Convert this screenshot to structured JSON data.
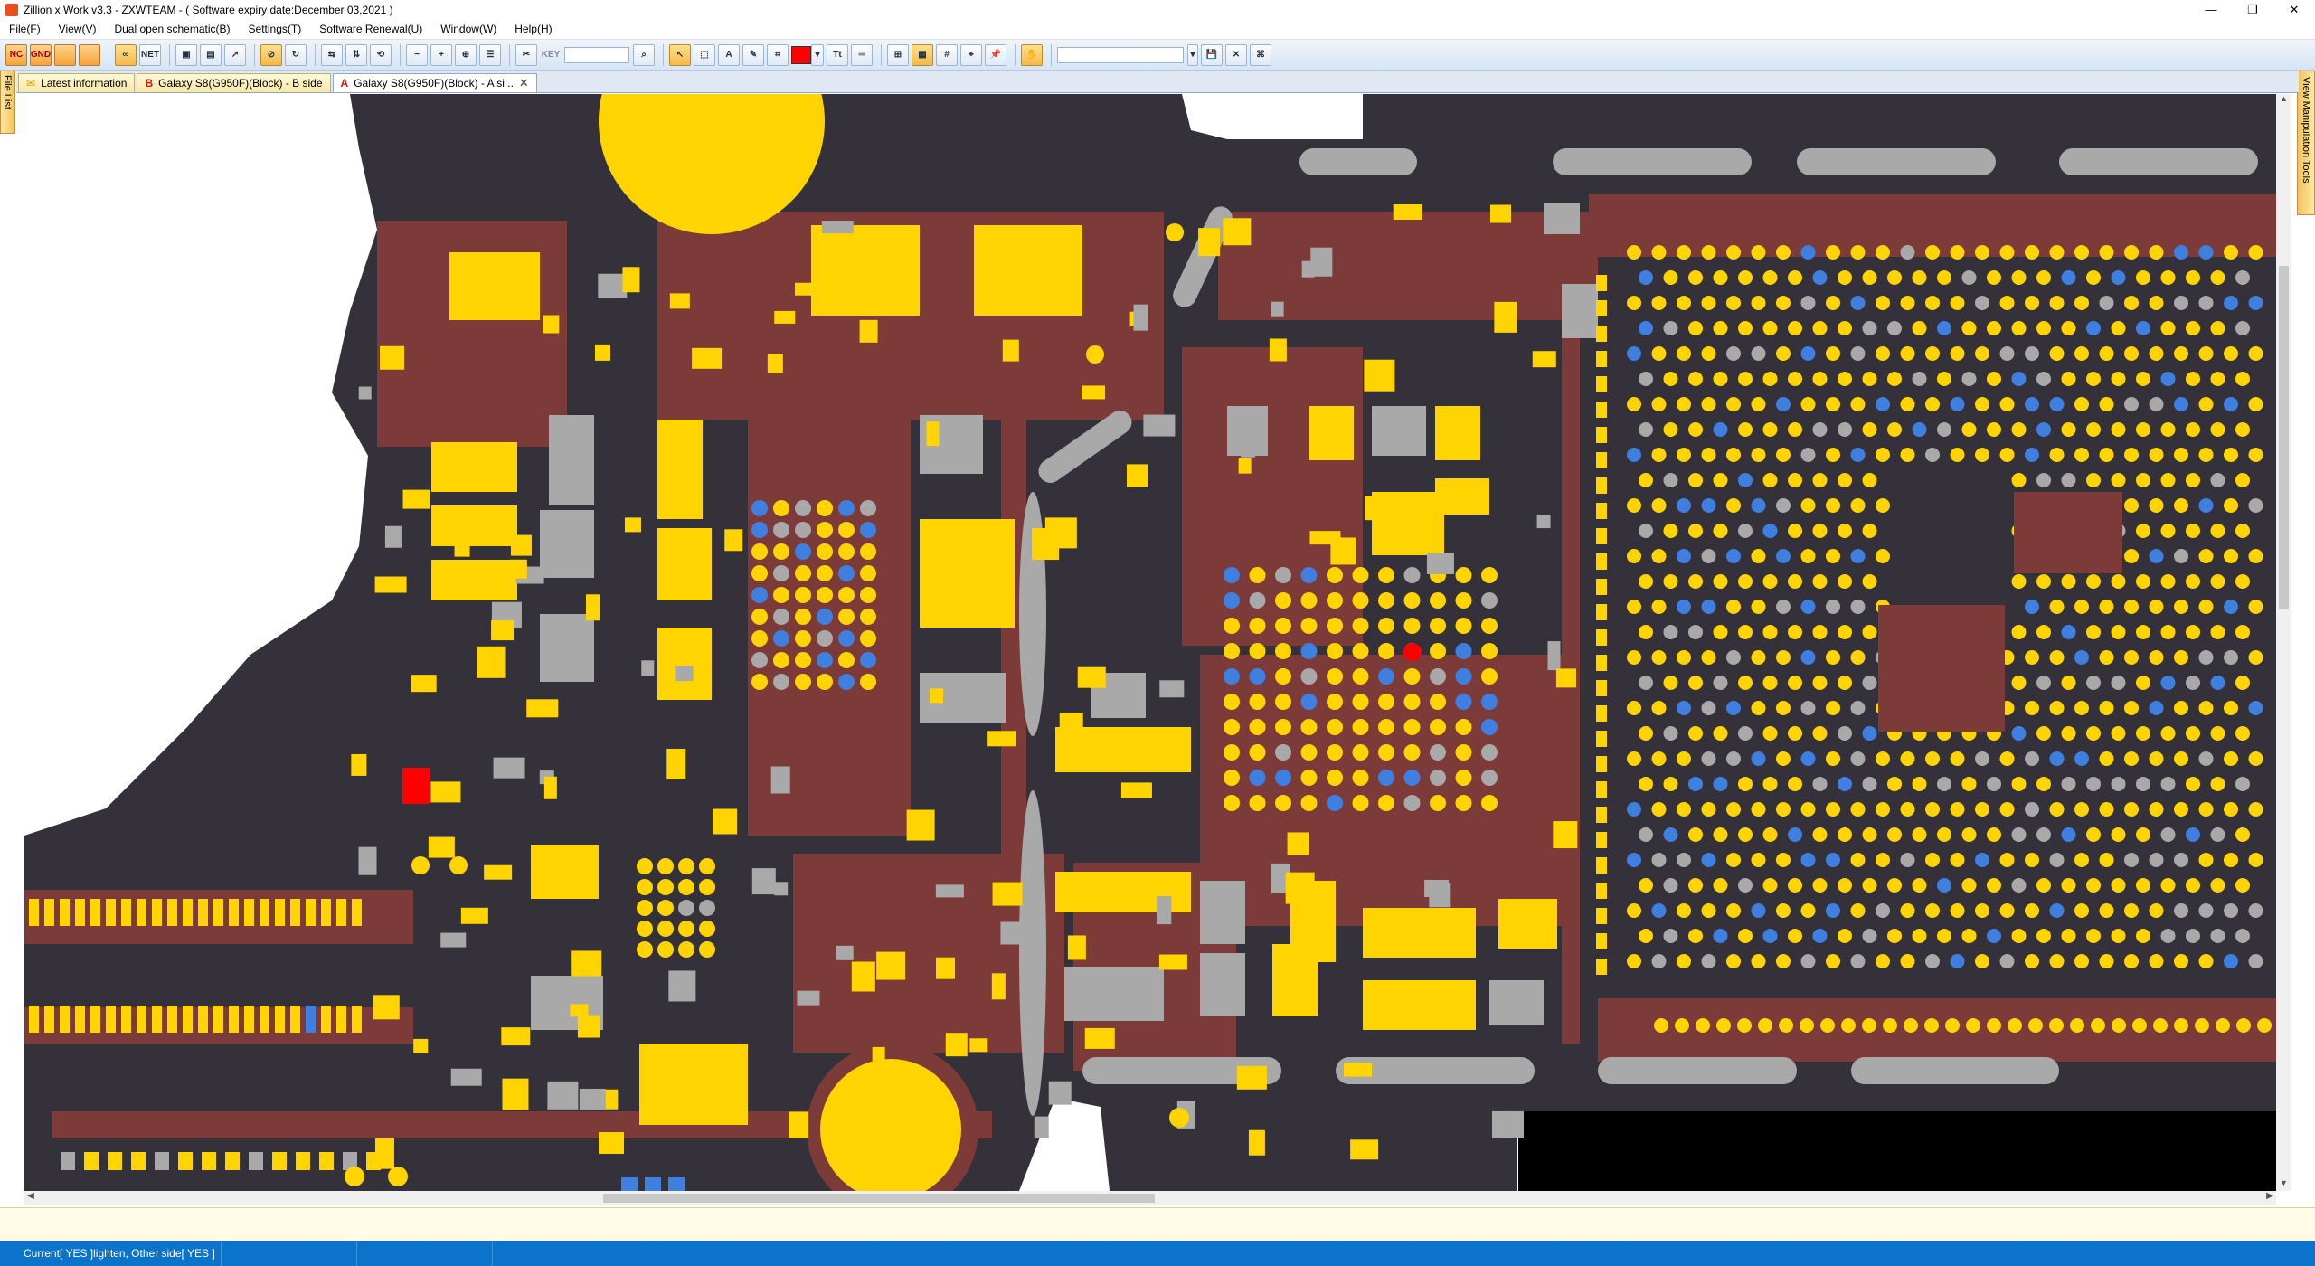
{
  "window": {
    "title": "Zillion x Work v3.3 - ZXWTEAM - ( Software expiry date:December 03,2021 )",
    "minimize": "—",
    "maximize": "❐",
    "close": "✕"
  },
  "menu": [
    "File(F)",
    "View(V)",
    "Dual open schematic(B)",
    "Settings(T)",
    "Software Renewal(U)",
    "Window(W)",
    "Help(H)"
  ],
  "toolbar": {
    "nc_label": "NC",
    "gnd_label": "GND",
    "net_label": "NET",
    "key_label": "KEY",
    "text_tool_label": "A",
    "font_tool_label": "Tt",
    "highlight_color": "#ff0000"
  },
  "tabs": [
    {
      "marker": "",
      "label": "Latest information",
      "active": false
    },
    {
      "marker": "B",
      "label": "Galaxy S8(G950F)(Block) - B side",
      "active": false
    },
    {
      "marker": "A",
      "label": "Galaxy S8(G950F)(Block) - A si...",
      "active": true
    }
  ],
  "side_panels": {
    "left": "File List",
    "right": "View Manipulation Tools"
  },
  "board": {
    "colors": {
      "substrate": "#35313a",
      "copper": "#7c3b39",
      "pad_yellow": "#ffd400",
      "pad_gray": "#a9a9a9",
      "pad_blue": "#3f7fe0",
      "selected_red": "#ff0000"
    }
  },
  "status": {
    "left": "Current[ YES ]lighten, Other side[ YES ]"
  }
}
